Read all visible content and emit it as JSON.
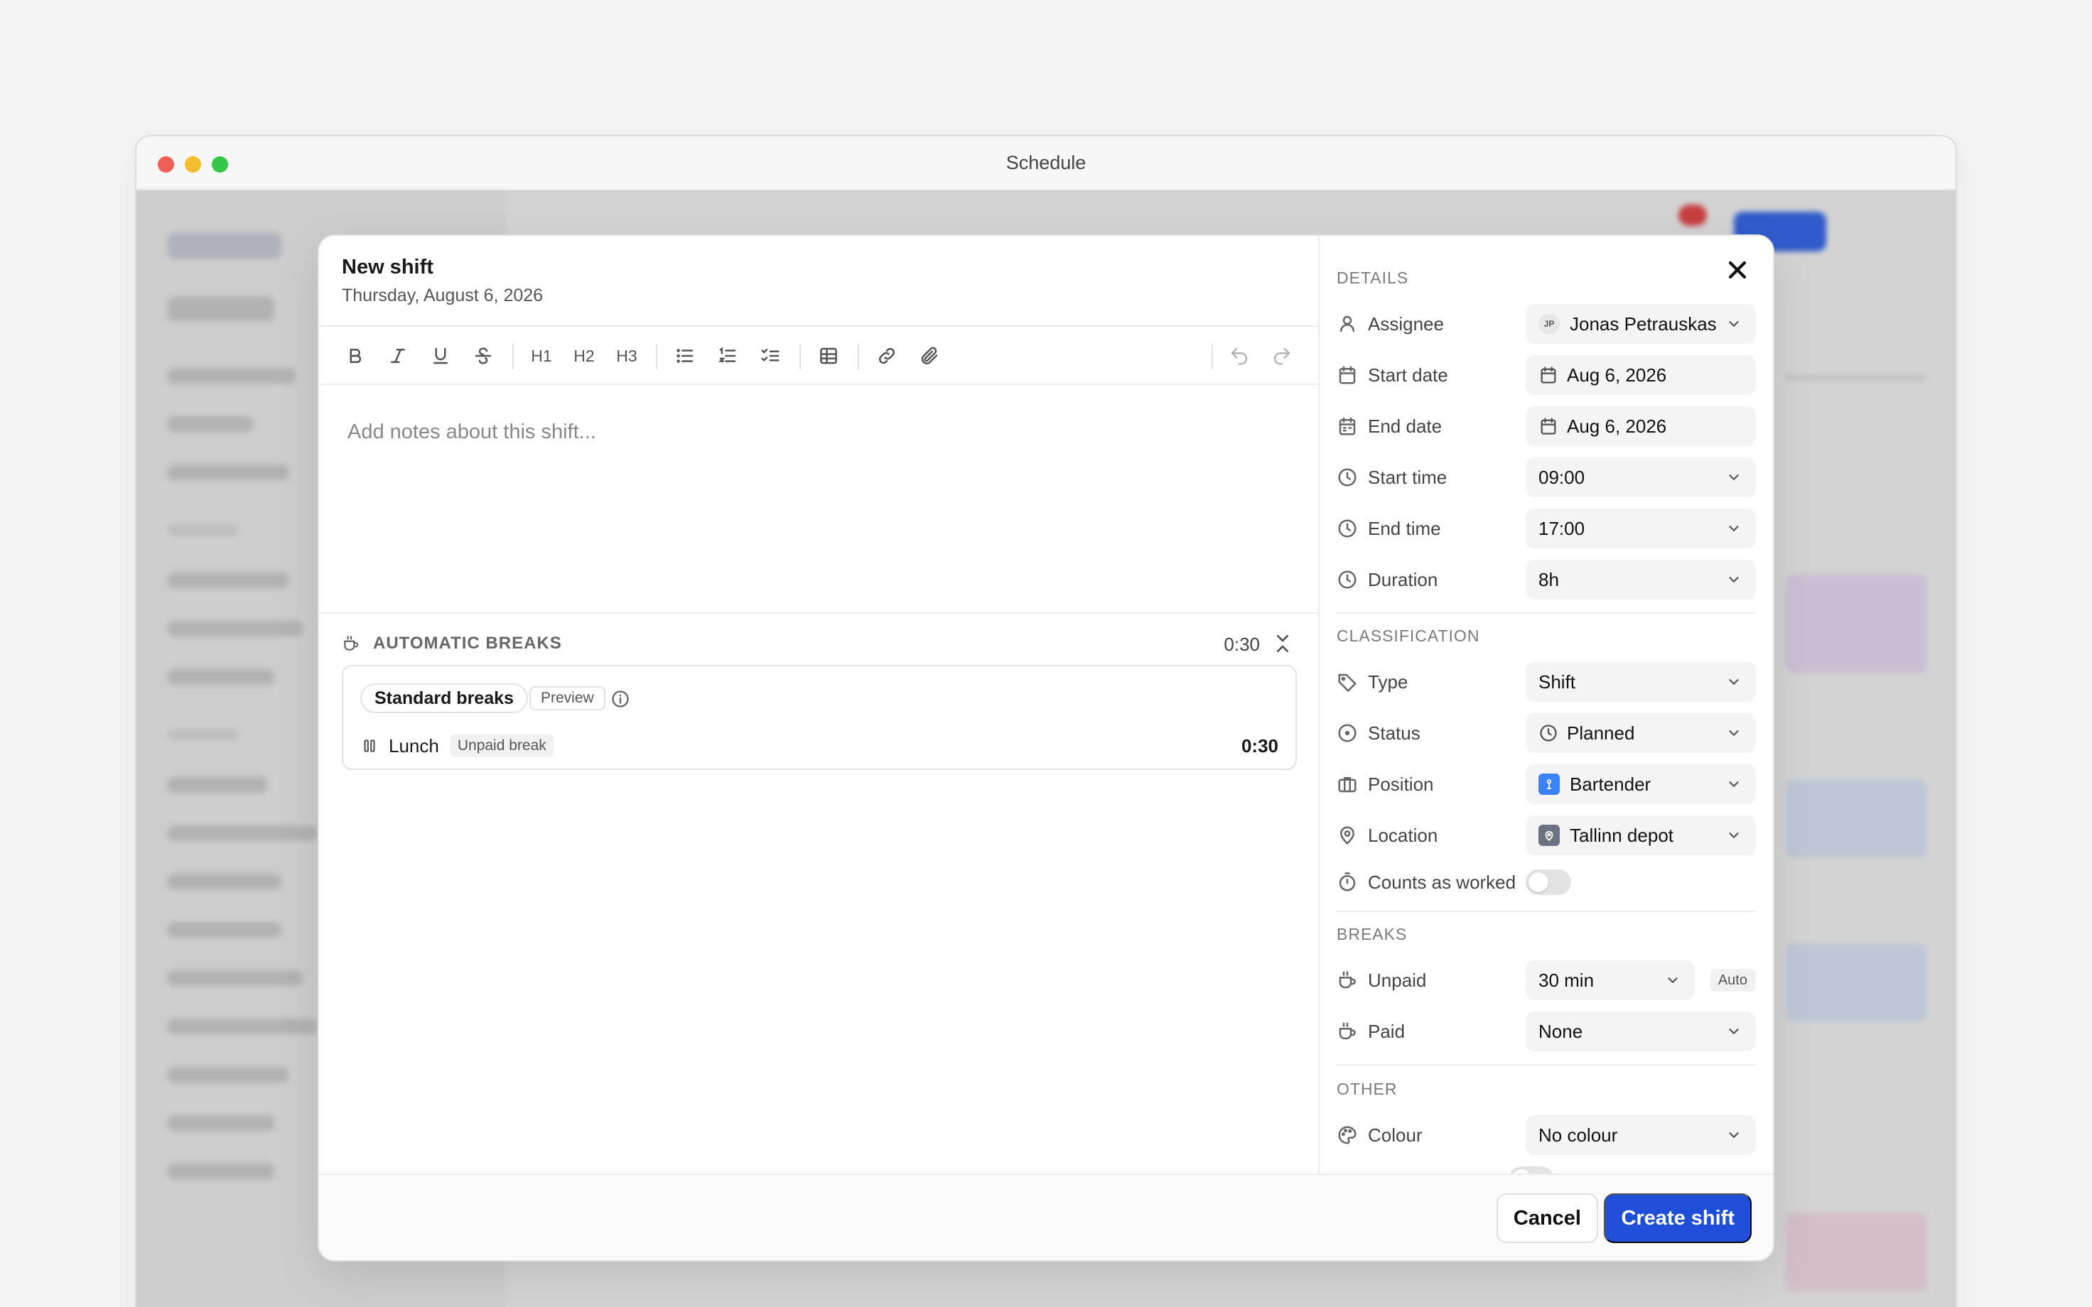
{
  "window": {
    "title": "Schedule"
  },
  "modal": {
    "title": "New shift",
    "subtitle": "Thursday, August 6, 2026",
    "toolbar": {
      "h1": "H1",
      "h2": "H2",
      "h3": "H3"
    },
    "notes_placeholder": "Add notes about this shift...",
    "auto_breaks": {
      "title": "AUTOMATIC BREAKS",
      "total": "0:30",
      "rule_name": "Standard breaks",
      "preview_label": "Preview",
      "items": [
        {
          "label": "Lunch",
          "tag": "Unpaid break",
          "duration": "0:30"
        }
      ]
    },
    "details": {
      "section": "DETAILS",
      "assignee_label": "Assignee",
      "assignee_initials": "JP",
      "assignee_value": "Jonas Petrauskas",
      "start_date_label": "Start date",
      "start_date_value": "Aug 6, 2026",
      "end_date_label": "End date",
      "end_date_value": "Aug 6, 2026",
      "start_time_label": "Start time",
      "start_time_value": "09:00",
      "end_time_label": "End time",
      "end_time_value": "17:00",
      "duration_label": "Duration",
      "duration_value": "8h"
    },
    "classification": {
      "section": "CLASSIFICATION",
      "type_label": "Type",
      "type_value": "Shift",
      "status_label": "Status",
      "status_value": "Planned",
      "position_label": "Position",
      "position_value": "Bartender",
      "position_color": "#3b82f6",
      "location_label": "Location",
      "location_value": "Tallinn depot",
      "location_color": "#6b7280",
      "counts_label": "Counts as worked",
      "counts_value": false
    },
    "breaks": {
      "section": "BREAKS",
      "unpaid_label": "Unpaid",
      "unpaid_value": "30 min",
      "auto_label": "Auto",
      "paid_label": "Paid",
      "paid_value": "None"
    },
    "other": {
      "section": "OTHER",
      "colour_label": "Colour",
      "colour_value": "No colour"
    },
    "footer": {
      "cancel_label": "Cancel",
      "create_label": "Create shift"
    },
    "colors": {
      "primary": "#1f4fd9"
    }
  }
}
